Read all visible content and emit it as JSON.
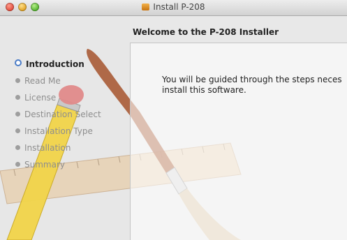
{
  "window": {
    "title": "Install P-208"
  },
  "content": {
    "heading": "Welcome to the P-208 Installer",
    "body_text": "You will be guided through the steps neces\ninstall this software."
  },
  "sidebar": {
    "steps": [
      {
        "label": "Introduction",
        "active": true
      },
      {
        "label": "Read Me",
        "active": false
      },
      {
        "label": "License",
        "active": false
      },
      {
        "label": "Destination Select",
        "active": false
      },
      {
        "label": "Installation Type",
        "active": false
      },
      {
        "label": "Installation",
        "active": false
      },
      {
        "label": "Summary",
        "active": false
      }
    ]
  },
  "colors": {
    "active_step_bullet": "#4a7cc7",
    "inactive_step_text": "#8e8e8e"
  },
  "icons": {
    "title_icon": "package-icon",
    "background_art": "pencil-ruler-brush-artwork"
  }
}
